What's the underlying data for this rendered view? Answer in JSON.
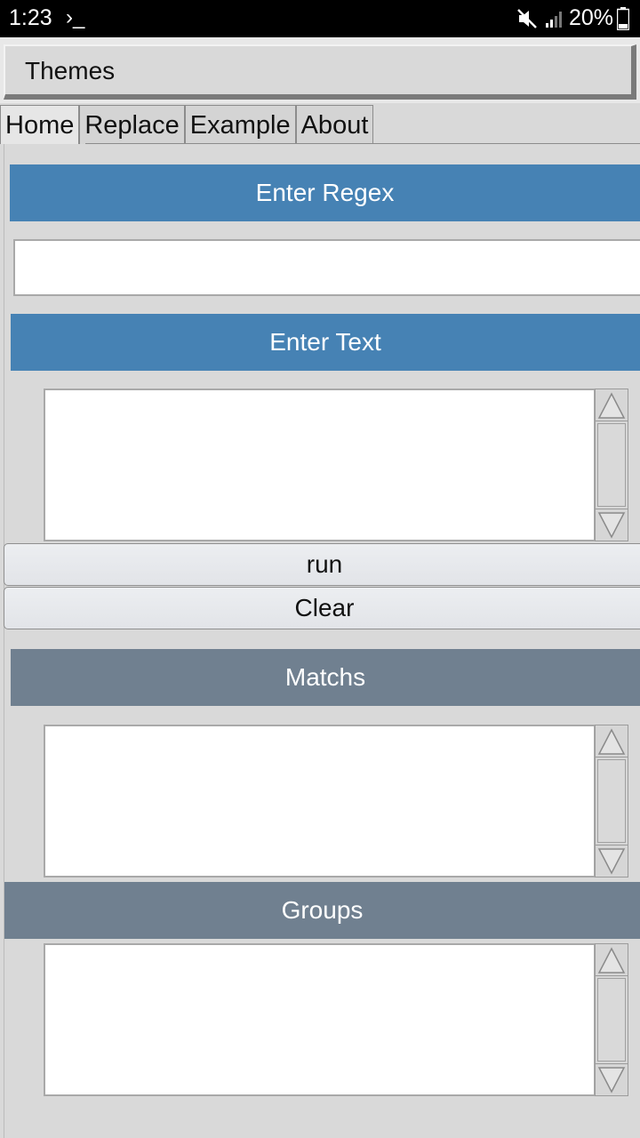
{
  "status_bar": {
    "time": "1:23",
    "terminal_glyph": "›_",
    "battery_percent": "20%",
    "icons": [
      "terminal-icon",
      "mute-icon",
      "signal-icon",
      "battery-icon"
    ]
  },
  "themes_menu": {
    "label": "Themes"
  },
  "tabs": [
    {
      "label": "Home",
      "active": true
    },
    {
      "label": "Replace",
      "active": false
    },
    {
      "label": "Example",
      "active": false
    },
    {
      "label": "About",
      "active": false
    }
  ],
  "sections": {
    "regex_header": "Enter Regex",
    "regex_input_value": "",
    "text_header": "Enter Text",
    "text_input_value": "",
    "matches_header": "Matchs",
    "matches_value": "",
    "groups_header": "Groups",
    "groups_value": ""
  },
  "buttons": {
    "run": "run",
    "clear": "Clear"
  },
  "colors": {
    "section_blue": "#4682b4",
    "section_gray": "#708090",
    "background": "#d9d9d9"
  }
}
